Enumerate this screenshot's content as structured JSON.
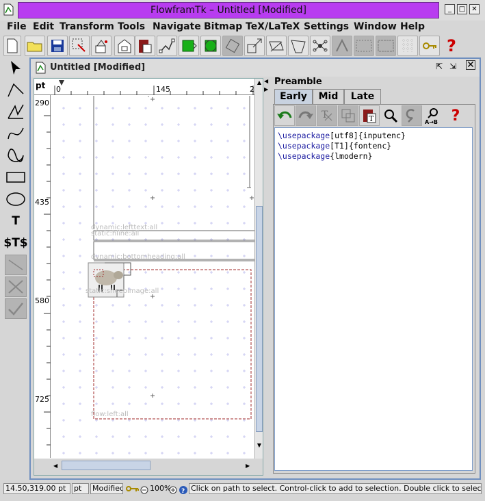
{
  "window": {
    "title": "FlowframTk – Untitled [Modified]"
  },
  "menu": [
    "File",
    "Edit",
    "Transform",
    "Tools",
    "Navigate",
    "Bitmap",
    "TeX/LaTeX",
    "Settings",
    "Window",
    "Help"
  ],
  "toolbar_icons": [
    "new-file-icon",
    "open-folder-icon",
    "save-icon",
    "select-all-icon",
    "cut-icon",
    "page-icon",
    "library-icon",
    "path-edit-icon",
    "frame-icon",
    "frame2-icon",
    "rotate-icon",
    "scale-icon",
    "shear-icon",
    "distort-icon",
    "node-icon",
    "tex-icon",
    "grid-icon",
    "grid2-icon",
    "lock-grid-icon",
    "key-icon",
    "help-icon"
  ],
  "left_tools": [
    "select-arrow-icon",
    "line-tool-icon",
    "closed-line-icon",
    "curve-tool-icon",
    "closed-curve-icon",
    "rectangle-tool-icon",
    "ellipse-tool-icon",
    "text-tool-icon",
    "math-text-tool-icon",
    "gap-tool-icon",
    "abandon-tool-icon",
    "finish-tool-icon"
  ],
  "left_tools_text": {
    "text": "T",
    "math": "$T$"
  },
  "inner": {
    "title": "Untitled [Modified]"
  },
  "rulers": {
    "unit": "pt",
    "top_ticks": [
      "0",
      "145",
      "2"
    ],
    "left_ticks": [
      "290",
      "435",
      "580",
      "725"
    ]
  },
  "canvas_labels": [
    "dynamic:lefttext:all",
    "static:hline:all",
    "dynamic:bottomheading:all",
    "static:sheepimage:all",
    "flow:left:all"
  ],
  "preamble": {
    "label": "Preamble",
    "tabs": [
      "Early",
      "Mid",
      "Late"
    ],
    "selected_tab": "Early",
    "tools": [
      "undo-icon",
      "redo-icon",
      "cut-icon",
      "copy-icon",
      "paste-icon",
      "find-icon",
      "find-again-icon",
      "replace-icon",
      "help-icon"
    ],
    "lines": [
      {
        "cmd": "\\usepackage",
        "rest": "[utf8]{inputenc}"
      },
      {
        "cmd": "\\usepackage",
        "rest": "[T1]{fontenc}"
      },
      {
        "cmd": "\\usepackage",
        "rest": "{lmodern}"
      }
    ]
  },
  "status": {
    "position": "14.50,319.00 pt",
    "unit": "pt",
    "modified": "Modified",
    "zoom": "100%",
    "message": "Click on path to select. Control-click to add to selection. Double click to select path unde"
  },
  "colors": {
    "title_bar": "#b83cf0",
    "inner_border": "#6f8fbf",
    "frame_dashed": "#a0282a",
    "grid_mark": "#c8c8f0"
  }
}
